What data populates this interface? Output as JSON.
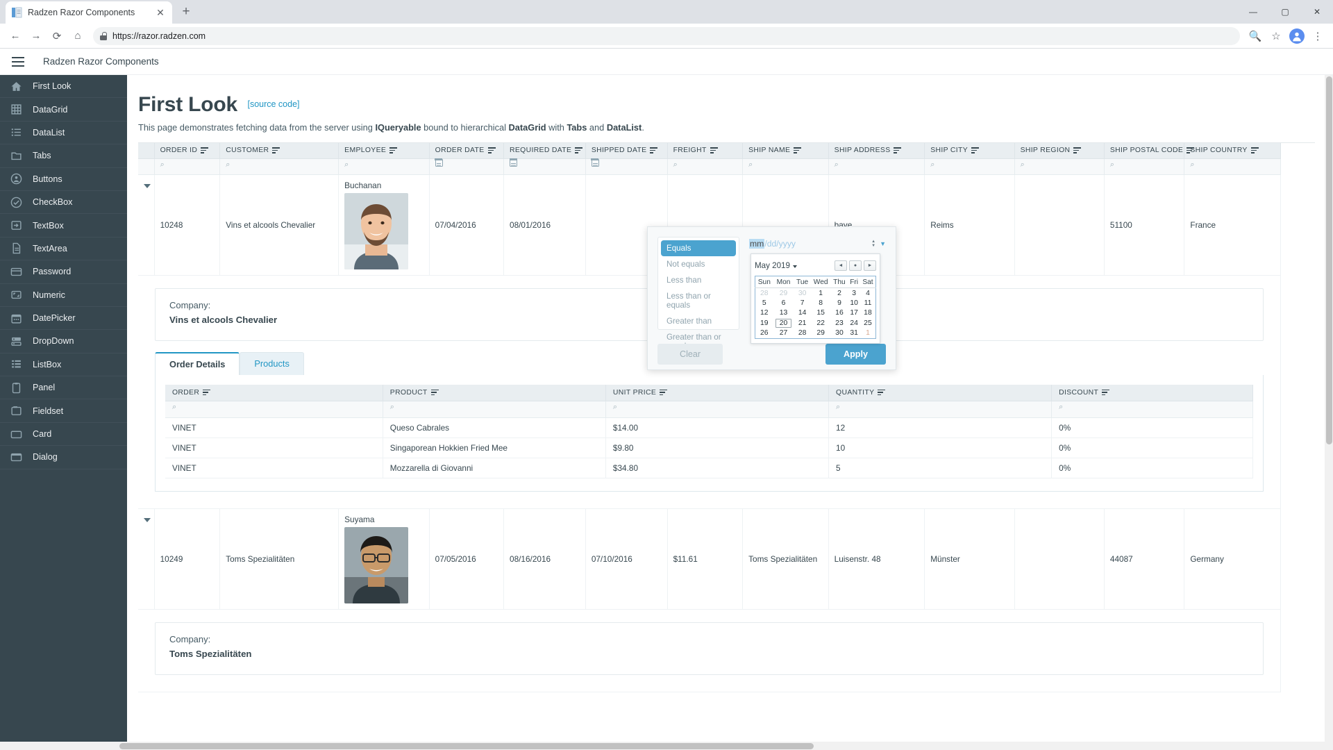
{
  "browser": {
    "tab_title": "Radzen Razor Components",
    "tab_favicon": "page-icon",
    "close_tab": "✕",
    "new_tab": "+",
    "back": "←",
    "forward": "→",
    "reload": "⟳",
    "home": "⌂",
    "url": "https://razor.radzen.com",
    "zoom_icon": "🔍",
    "bookmark_icon": "☆",
    "menu_icon": "⋮",
    "minimize": "—",
    "maximize": "▢",
    "close": "✕"
  },
  "app": {
    "title": "Radzen Razor Components",
    "menu_button": "hamburger-menu"
  },
  "sidebar": {
    "items": [
      {
        "label": "First Look",
        "icon": "home-icon"
      },
      {
        "label": "DataGrid",
        "icon": "grid-icon"
      },
      {
        "label": "DataList",
        "icon": "list-icon"
      },
      {
        "label": "Tabs",
        "icon": "folder-icon"
      },
      {
        "label": "Buttons",
        "icon": "person-circle-icon"
      },
      {
        "label": "CheckBox",
        "icon": "check-circle-icon"
      },
      {
        "label": "TextBox",
        "icon": "input-arrow-icon"
      },
      {
        "label": "TextArea",
        "icon": "document-icon"
      },
      {
        "label": "Password",
        "icon": "card-icon"
      },
      {
        "label": "Numeric",
        "icon": "resize-icon"
      },
      {
        "label": "DatePicker",
        "icon": "calendar-icon"
      },
      {
        "label": "DropDown",
        "icon": "dropdown-icon"
      },
      {
        "label": "ListBox",
        "icon": "listbox-icon"
      },
      {
        "label": "Panel",
        "icon": "panel-icon"
      },
      {
        "label": "Fieldset",
        "icon": "fieldset-icon"
      },
      {
        "label": "Card",
        "icon": "card2-icon"
      },
      {
        "label": "Dialog",
        "icon": "dialog-icon"
      }
    ]
  },
  "main": {
    "title": "First Look",
    "source_link": "[source code]",
    "subtitle_parts": {
      "p1": "This page demonstrates fetching data from the server using ",
      "b1": "IQueryable",
      "p2": " bound to hierarchical ",
      "b2": "DataGrid",
      "p3": " with ",
      "b3": "Tabs",
      "p4": " and ",
      "b4": "DataList",
      "p5": "."
    }
  },
  "grid": {
    "columns": [
      "ORDER ID",
      "CUSTOMER",
      "EMPLOYEE",
      "ORDER DATE",
      "REQUIRED DATE",
      "SHIPPED DATE",
      "FREIGHT",
      "SHIP NAME",
      "SHIP ADDRESS",
      "SHIP CITY",
      "SHIP REGION",
      "SHIP POSTAL CODE",
      "SHIP COUNTRY"
    ],
    "filter_icons": [
      "search-icon",
      "search-icon",
      "search-icon",
      "calendar-icon",
      "calendar-icon",
      "calendar-icon",
      "search-icon",
      "search-icon",
      "search-icon",
      "search-icon",
      "search-icon",
      "search-icon",
      "search-icon"
    ],
    "rows": [
      {
        "order_id": "10248",
        "customer": "Vins et alcools Chevalier",
        "employee": "Buchanan",
        "order_date": "07/04/2016",
        "required_date": "08/01/2016",
        "shipped_date": "",
        "freight": "",
        "ship_name": "",
        "ship_address": "baye",
        "ship_city": "Reims",
        "ship_region": "",
        "ship_postal_code": "51100",
        "ship_country": "France",
        "detail": {
          "company_label": "Company:",
          "company_name": "Vins et alcools Chevalier",
          "tabs": [
            {
              "label": "Order Details",
              "active": true
            },
            {
              "label": "Products",
              "active": false
            }
          ],
          "sub_columns": [
            "ORDER",
            "PRODUCT",
            "UNIT PRICE",
            "QUANTITY",
            "DISCOUNT"
          ],
          "sub_rows": [
            {
              "order": "VINET",
              "product": "Queso Cabrales",
              "unit_price": "$14.00",
              "quantity": "12",
              "discount": "0%"
            },
            {
              "order": "VINET",
              "product": "Singaporean Hokkien Fried Mee",
              "unit_price": "$9.80",
              "quantity": "10",
              "discount": "0%"
            },
            {
              "order": "VINET",
              "product": "Mozzarella di Giovanni",
              "unit_price": "$34.80",
              "quantity": "5",
              "discount": "0%"
            }
          ]
        }
      },
      {
        "order_id": "10249",
        "customer": "Toms Spezialitäten",
        "employee": "Suyama",
        "order_date": "07/05/2016",
        "required_date": "08/16/2016",
        "shipped_date": "07/10/2016",
        "freight": "$11.61",
        "ship_name": "Toms Spezialitäten",
        "ship_address": "Luisenstr. 48",
        "ship_city": "Münster",
        "ship_region": "",
        "ship_postal_code": "44087",
        "ship_country": "Germany",
        "detail": {
          "company_label": "Company:",
          "company_name": "Toms Spezialitäten"
        }
      }
    ]
  },
  "filter_popup": {
    "operators": [
      {
        "label": "Equals",
        "selected": true
      },
      {
        "label": "Not equals",
        "selected": false
      },
      {
        "label": "Less than",
        "selected": false
      },
      {
        "label": "Less than or equals",
        "selected": false
      },
      {
        "label": "Greater than",
        "selected": false
      },
      {
        "label": "Greater than or equals",
        "selected": false
      }
    ],
    "date_input": {
      "mask_active": "mm",
      "mask_rest": "/dd/yyyy"
    },
    "calendar": {
      "title": "May 2019",
      "nav_prev": "◄",
      "nav_today": "●",
      "nav_next": "►",
      "weekdays": [
        "Sun",
        "Mon",
        "Tue",
        "Wed",
        "Thu",
        "Fri",
        "Sat"
      ],
      "weeks": [
        [
          {
            "d": "28",
            "t": "prev"
          },
          {
            "d": "29",
            "t": "prev"
          },
          {
            "d": "30",
            "t": "prev"
          },
          {
            "d": "1",
            "t": "cur"
          },
          {
            "d": "2",
            "t": "cur"
          },
          {
            "d": "3",
            "t": "cur"
          },
          {
            "d": "4",
            "t": "cur"
          }
        ],
        [
          {
            "d": "5",
            "t": "cur"
          },
          {
            "d": "6",
            "t": "cur"
          },
          {
            "d": "7",
            "t": "cur"
          },
          {
            "d": "8",
            "t": "cur"
          },
          {
            "d": "9",
            "t": "cur"
          },
          {
            "d": "10",
            "t": "cur"
          },
          {
            "d": "11",
            "t": "cur"
          }
        ],
        [
          {
            "d": "12",
            "t": "cur"
          },
          {
            "d": "13",
            "t": "cur"
          },
          {
            "d": "14",
            "t": "cur"
          },
          {
            "d": "15",
            "t": "cur"
          },
          {
            "d": "16",
            "t": "cur"
          },
          {
            "d": "17",
            "t": "cur"
          },
          {
            "d": "18",
            "t": "cur"
          }
        ],
        [
          {
            "d": "19",
            "t": "cur"
          },
          {
            "d": "20",
            "t": "sel"
          },
          {
            "d": "21",
            "t": "cur"
          },
          {
            "d": "22",
            "t": "cur"
          },
          {
            "d": "23",
            "t": "cur"
          },
          {
            "d": "24",
            "t": "cur"
          },
          {
            "d": "25",
            "t": "cur"
          }
        ],
        [
          {
            "d": "26",
            "t": "cur"
          },
          {
            "d": "27",
            "t": "cur"
          },
          {
            "d": "28",
            "t": "cur"
          },
          {
            "d": "29",
            "t": "cur"
          },
          {
            "d": "30",
            "t": "cur"
          },
          {
            "d": "31",
            "t": "cur"
          },
          {
            "d": "1",
            "t": "next"
          }
        ]
      ]
    },
    "clear_label": "Clear",
    "apply_label": "Apply"
  },
  "colors": {
    "sidebar_bg": "#37474f",
    "accent": "#4ba3cf",
    "link": "#2196c4",
    "header_bg": "#e9eef1"
  }
}
